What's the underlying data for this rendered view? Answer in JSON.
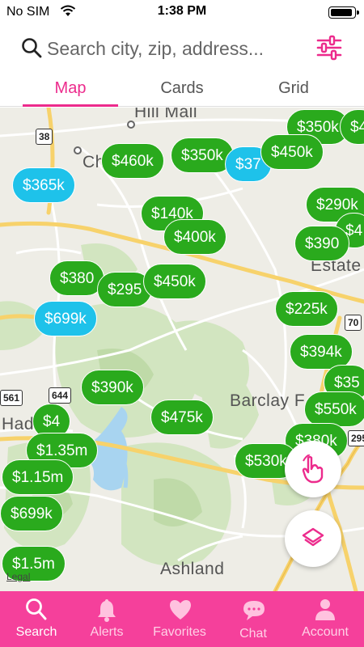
{
  "status_bar": {
    "carrier": "No SIM",
    "time": "1:38 PM"
  },
  "search": {
    "placeholder": "Search city, zip, address..."
  },
  "tabs": [
    {
      "label": "Map",
      "active": true
    },
    {
      "label": "Cards",
      "active": false
    },
    {
      "label": "Grid",
      "active": false
    }
  ],
  "map": {
    "labels": {
      "hill_mall": "Hill Mall",
      "ch": "Ch",
      "estate": "Estate",
      "barclay": "Barclay F",
      "had": "Had",
      "ashland": "Ashland"
    },
    "shields": {
      "r38": "38",
      "r644": "644",
      "r561": "561",
      "r70": "70",
      "r295": "295"
    },
    "legal": "Legal",
    "pins": [
      {
        "price": "$365k",
        "color": "blue"
      },
      {
        "price": "$460k",
        "color": "green"
      },
      {
        "price": "$350k",
        "color": "green"
      },
      {
        "price": "$37",
        "color": "blue"
      },
      {
        "price": "$450k",
        "color": "green"
      },
      {
        "price": "$350k",
        "color": "green"
      },
      {
        "price": "$4",
        "color": "green"
      },
      {
        "price": "$140k",
        "color": "green"
      },
      {
        "price": "$400k",
        "color": "green"
      },
      {
        "price": "$290k",
        "color": "green"
      },
      {
        "price": "$4",
        "color": "green"
      },
      {
        "price": "$390",
        "color": "green"
      },
      {
        "price": "$380",
        "color": "green"
      },
      {
        "price": "$295",
        "color": "green"
      },
      {
        "price": "$450k",
        "color": "green"
      },
      {
        "price": "$699k",
        "color": "blue"
      },
      {
        "price": "$225k",
        "color": "green"
      },
      {
        "price": "$394k",
        "color": "green"
      },
      {
        "price": "$35",
        "color": "green"
      },
      {
        "price": "$390k",
        "color": "green"
      },
      {
        "price": "$4",
        "color": "green"
      },
      {
        "price": "$475k",
        "color": "green"
      },
      {
        "price": "$550k",
        "color": "green"
      },
      {
        "price": "$1.35m",
        "color": "green"
      },
      {
        "price": "$380k",
        "color": "green"
      },
      {
        "price": "$530k",
        "color": "green"
      },
      {
        "price": "$1.15m",
        "color": "green"
      },
      {
        "price": "$699k",
        "color": "green"
      },
      {
        "price": "$1.5m",
        "color": "green"
      }
    ]
  },
  "nav": [
    {
      "label": "Search",
      "icon": "search-icon",
      "active": true
    },
    {
      "label": "Alerts",
      "icon": "bell-icon",
      "active": false
    },
    {
      "label": "Favorites",
      "icon": "heart-icon",
      "active": false
    },
    {
      "label": "Chat",
      "icon": "chat-bubble-icon",
      "active": false
    },
    {
      "label": "Account",
      "icon": "person-icon",
      "active": false
    }
  ],
  "colors": {
    "accent": "#ec2b8c",
    "nav_bg": "#f5409b",
    "pin_green": "#2aaa1d",
    "pin_blue": "#1ec2ea",
    "road_yellow": "#f7d26b"
  }
}
